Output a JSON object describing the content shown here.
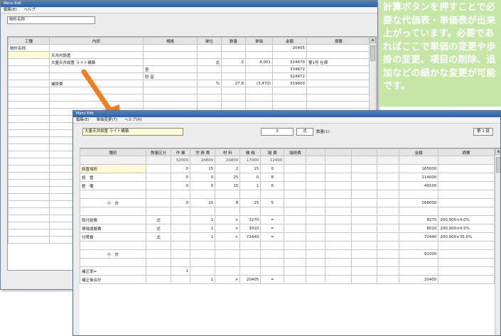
{
  "back_window": {
    "title": "Menu Edit",
    "menu": [
      "編集(E)",
      "ヘルプ"
    ],
    "search_value": "物件名称",
    "columns": [
      "工種",
      "内訳",
      "規格",
      "単位",
      "数量",
      "単価",
      "金額",
      "摘要"
    ],
    "rows": [
      [
        "物件名称",
        "",
        "",
        "",
        "",
        "",
        "20405",
        ""
      ],
      [
        "",
        "天井内設置",
        "",
        "",
        "",
        "",
        "",
        ""
      ],
      [
        "",
        "大量天井設置 ライト構築",
        "",
        "式",
        "2",
        "4,001",
        "324470",
        "第1号 仕様"
      ],
      [
        "",
        "",
        "室",
        "",
        "",
        "",
        "334672",
        ""
      ],
      [
        "",
        "",
        "防 音",
        "",
        "",
        "",
        "324472",
        ""
      ],
      [
        "",
        "補修費",
        "",
        "%",
        "27.8",
        "(3,470)",
        "319600",
        ""
      ]
    ]
  },
  "front_window": {
    "title": "Menu Edit",
    "menu": [
      "編集(E)",
      "単価変更(T)",
      "ヘルプ(H)"
    ],
    "item_name": "大量天井設置 ライト構築",
    "quantity": "3",
    "unit": "式",
    "calc_label": "数量(1)",
    "page_button": "第 1 頁",
    "columns": [
      "種別",
      "数量区分",
      "作 業",
      "労 務 費",
      "材 料",
      "機 械",
      "雑 費",
      "諸経費",
      "",
      "",
      "",
      "",
      "金額",
      "摘要"
    ],
    "price_row": [
      "",
      "",
      "32000",
      "24800",
      "20800",
      "17000",
      "12400",
      "",
      "",
      "",
      "",
      "",
      "",
      ""
    ],
    "rows": [
      [
        "設置場所",
        "",
        "0",
        "15",
        "2",
        "15",
        "0",
        "",
        "",
        "",
        "",
        "",
        "165000",
        ""
      ],
      [
        "設　置",
        "",
        "0",
        "0",
        "25",
        "0",
        "8",
        "",
        "",
        "",
        "",
        "",
        "114000",
        ""
      ],
      [
        "整　備",
        "",
        "0",
        "0",
        "15",
        "1",
        "6",
        "",
        "",
        "",
        "",
        "",
        "49100",
        ""
      ],
      [
        "",
        "",
        "",
        "",
        "",
        "",
        "",
        "",
        "",
        "",
        "",
        "",
        "",
        ""
      ],
      [
        "小　計",
        "",
        "0",
        "15",
        "8",
        "25",
        "5",
        "",
        "",
        "",
        "",
        "",
        "268000",
        ""
      ],
      [
        "",
        "",
        "",
        "",
        "",
        "",
        "",
        "",
        "",
        "",
        "",
        "",
        "",
        ""
      ],
      [
        "取付経費",
        "式",
        "",
        "1",
        "×",
        "3270",
        "=",
        "",
        "",
        "",
        "",
        "",
        "8270",
        "200,900×4.0%"
      ],
      [
        "現場運搬費",
        "式",
        "",
        "1",
        "×",
        "3010",
        "=",
        "",
        "",
        "",
        "",
        "",
        "8010",
        "200,900×4.5%"
      ],
      [
        "付帯費",
        "式",
        "",
        "1",
        "×",
        "72440",
        "=",
        "",
        "",
        "",
        "",
        "",
        "72440",
        "200,900×35.0%"
      ],
      [
        "",
        "",
        "",
        "",
        "",
        "",
        "",
        "",
        "",
        "",
        "",
        "",
        "",
        ""
      ],
      [
        "小　計",
        "",
        "",
        "",
        "",
        "",
        "",
        "",
        "",
        "",
        "",
        "",
        "91000",
        ""
      ],
      [
        "",
        "",
        "",
        "",
        "",
        "",
        "",
        "",
        "",
        "",
        "",
        "",
        "",
        ""
      ],
      [
        "補正率=",
        "",
        "1",
        "",
        "",
        "",
        "",
        "",
        "",
        "",
        "",
        "",
        "",
        ""
      ],
      [
        "補正後合計",
        "",
        "",
        "1",
        "×",
        "20405",
        "=",
        "",
        "",
        "",
        "",
        "",
        "20405",
        ""
      ]
    ]
  },
  "callout": {
    "text": "計算ボタンを押すことで必要な代価表・単価表が出来上がっています。必要であればここで単価の変更や歩掛の変更、項目の削除、追加などの細かな変更が可能です。"
  },
  "colors": {
    "titlebar": "#2f5f9f",
    "callout_bg": "#c5e6a6",
    "arrow": "#f07d1f",
    "selected_cell": "#fffbd6"
  }
}
